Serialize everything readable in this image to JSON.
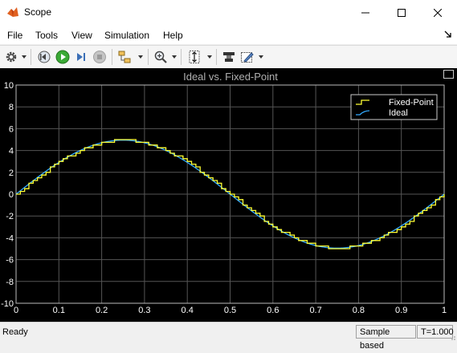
{
  "window": {
    "title": "Scope"
  },
  "menu": [
    "File",
    "Tools",
    "View",
    "Simulation",
    "Help"
  ],
  "toolbar": {
    "icons": [
      "gear-icon",
      "step-back-icon",
      "run-icon",
      "step-forward-icon",
      "stop-icon",
      "signal-select-icon",
      "zoom-icon",
      "scale-axes-icon",
      "cursor-measure-icon",
      "highlight-icon"
    ]
  },
  "plot": {
    "title": "Ideal vs. Fixed-Point",
    "legend": [
      "Fixed-Point",
      "Ideal"
    ],
    "colors": {
      "fixed_point": "#ffff33",
      "ideal": "#33aaff",
      "grid": "#555555",
      "axis_text": "#ffffff",
      "title": "#b0b0b0"
    }
  },
  "chart_data": {
    "type": "line",
    "title": "Ideal vs. Fixed-Point",
    "xlabel": "",
    "ylabel": "",
    "xlim": [
      0,
      1
    ],
    "ylim": [
      -10,
      10
    ],
    "x_ticks": [
      "0",
      "0.1",
      "0.2",
      "0.3",
      "0.4",
      "0.5",
      "0.6",
      "0.7",
      "0.8",
      "0.9",
      "1"
    ],
    "y_ticks": [
      "10",
      "8",
      "6",
      "4",
      "2",
      "0",
      "-2",
      "-4",
      "-6",
      "-8",
      "-10"
    ],
    "grid": true,
    "legend_position": "top-right",
    "series": [
      {
        "name": "Fixed-Point",
        "style": "stairs",
        "step": 0.01,
        "amplitude": 4.95,
        "frequency": 1,
        "quantization": 0.25
      },
      {
        "name": "Ideal",
        "style": "line",
        "amplitude": 4.95,
        "frequency": 1
      }
    ]
  },
  "status": {
    "ready": "Ready",
    "mode": "Sample based",
    "time": "T=1.000"
  }
}
